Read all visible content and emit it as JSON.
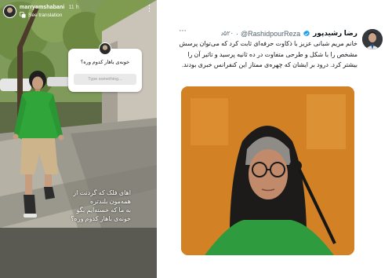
{
  "story": {
    "username": "marryamshabani",
    "time": "11 h",
    "translate_label": "See translation",
    "question_box": {
      "question": "خونه‌ی باهار کدوم وره؟",
      "placeholder": "Type something..."
    },
    "caption_lines": [
      "اهای فلک که گردنت از",
      "همه‌مون بلندتره",
      "به ما که خسته‌ایم بگو",
      "خونه‌ی باهار کدوم وره؟"
    ]
  },
  "tweet": {
    "name": "رضا رشیدپور",
    "handle": "@RashidpourReza",
    "time": "۵۲۰د",
    "text": "خانم مریم شبانی عزیز با ذکاوت حرفه‌ای ثابت کرد که می‌توان پرسش مشخص را با شکل و طرحی متفاوت در ده ثانیه پرسید و تاثیر آن را بیشتر کرد. درود بر ایشان که چهره‌ی ممتاز این کنفرانس خبری بودند."
  },
  "colors": {
    "story_dress": "#2fa53a",
    "verified": "#1d9bf0",
    "tweet_media_bg": "#d7861f"
  }
}
